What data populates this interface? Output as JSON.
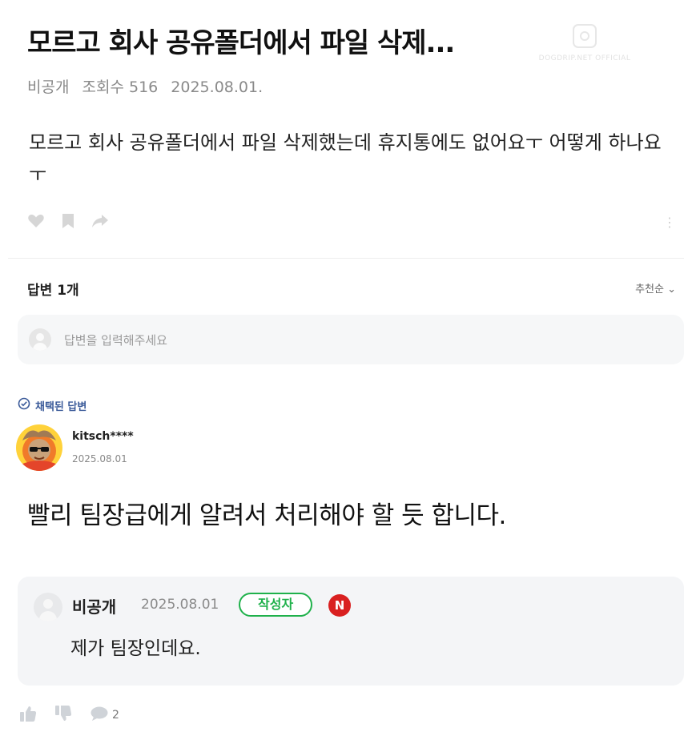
{
  "post": {
    "title": "모르고 회사 공유폴더에서 파일 삭제...",
    "author": "비공개",
    "views": "조회수 516",
    "date": "2025.08.01.",
    "body": "모르고 회사 공유폴더에서 파일 삭제했는데 휴지통에도 없어요ㅜ 어떻게 하나요ㅜ"
  },
  "watermark": {
    "icon": "instagram-icon",
    "text": "DOGDRIP.NET OFFICIAL"
  },
  "answers": {
    "count_label": "답변 1개",
    "sort_label": "추천순",
    "input_placeholder": "답변을 입력해주세요",
    "chosen_label": "채택된 답변"
  },
  "answer": {
    "username": "kitsch****",
    "date": "2025.08.01",
    "text": "빨리 팀장급에게 알려서 처리해야 할 듯 합니다."
  },
  "reply": {
    "username": "비공개",
    "date": "2025.08.01",
    "badge": "작성자",
    "n_badge": "N",
    "text": "제가 팀장인데요."
  },
  "bottom": {
    "comment_count": "2"
  },
  "colors": {
    "accent_green": "#1fb14b",
    "chosen_blue": "#3a5a99",
    "n_badge_red": "#d92020"
  }
}
